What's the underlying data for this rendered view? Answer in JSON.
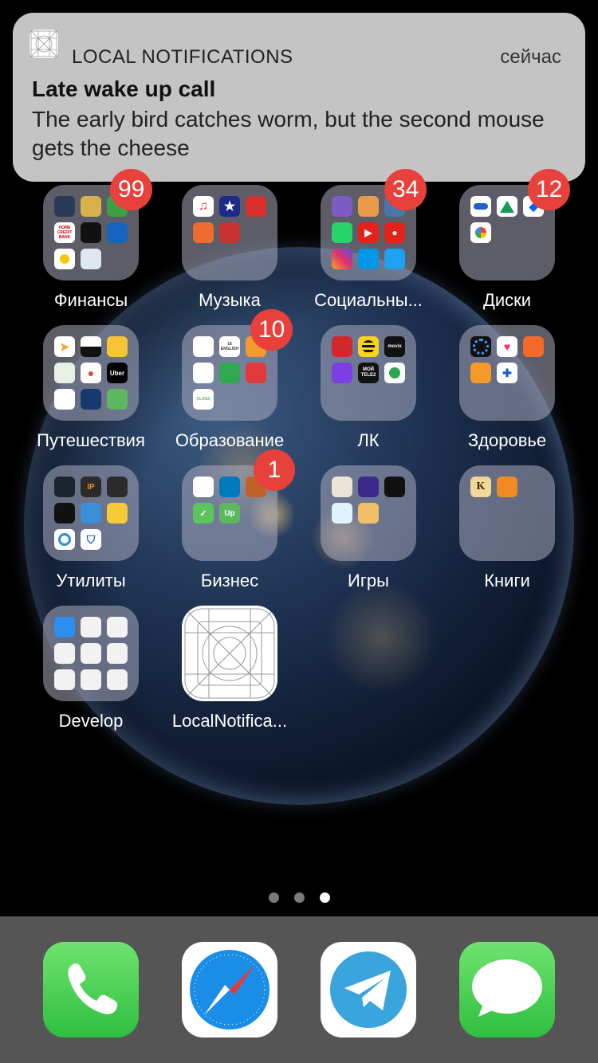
{
  "notification": {
    "app_name": "LOCAL NOTIFICATIONS",
    "time": "сейчас",
    "title": "Late wake up call",
    "body": "The early bird catches worm, but the second mouse gets the cheese"
  },
  "folders": [
    {
      "label": "Финансы",
      "badge": "99"
    },
    {
      "label": "Музыка",
      "badge": ""
    },
    {
      "label": "Социальны...",
      "badge": "34"
    },
    {
      "label": "Диски",
      "badge": "12"
    },
    {
      "label": "Путешествия",
      "badge": ""
    },
    {
      "label": "Образование",
      "badge": "10"
    },
    {
      "label": "ЛК",
      "badge": ""
    },
    {
      "label": "Здоровье",
      "badge": ""
    },
    {
      "label": "Утилиты",
      "badge": ""
    },
    {
      "label": "Бизнес",
      "badge": "1"
    },
    {
      "label": "Игры",
      "badge": ""
    },
    {
      "label": "Книги",
      "badge": ""
    },
    {
      "label": "Develop",
      "badge": ""
    }
  ],
  "app": {
    "label": "LocalNotifica..."
  },
  "page_dots": {
    "count": 3,
    "active": 3
  },
  "dock": [
    {
      "name": "phone-icon",
      "color": "#4cd964"
    },
    {
      "name": "safari-icon",
      "color": "#1e88e5"
    },
    {
      "name": "telegram-icon",
      "color": "#37a6dc"
    },
    {
      "name": "messages-icon",
      "color": "#4cd964"
    }
  ],
  "mini_icon_text": {
    "uber": "Uber",
    "movix": "movix",
    "ip": "IP",
    "up": "Up",
    "k": "K",
    "moi_tele2": "МОЙ TELE2",
    "home_credit": "HOME CREDIT BANK",
    "class": "CLASS",
    "en": "16 ENGLISH"
  }
}
